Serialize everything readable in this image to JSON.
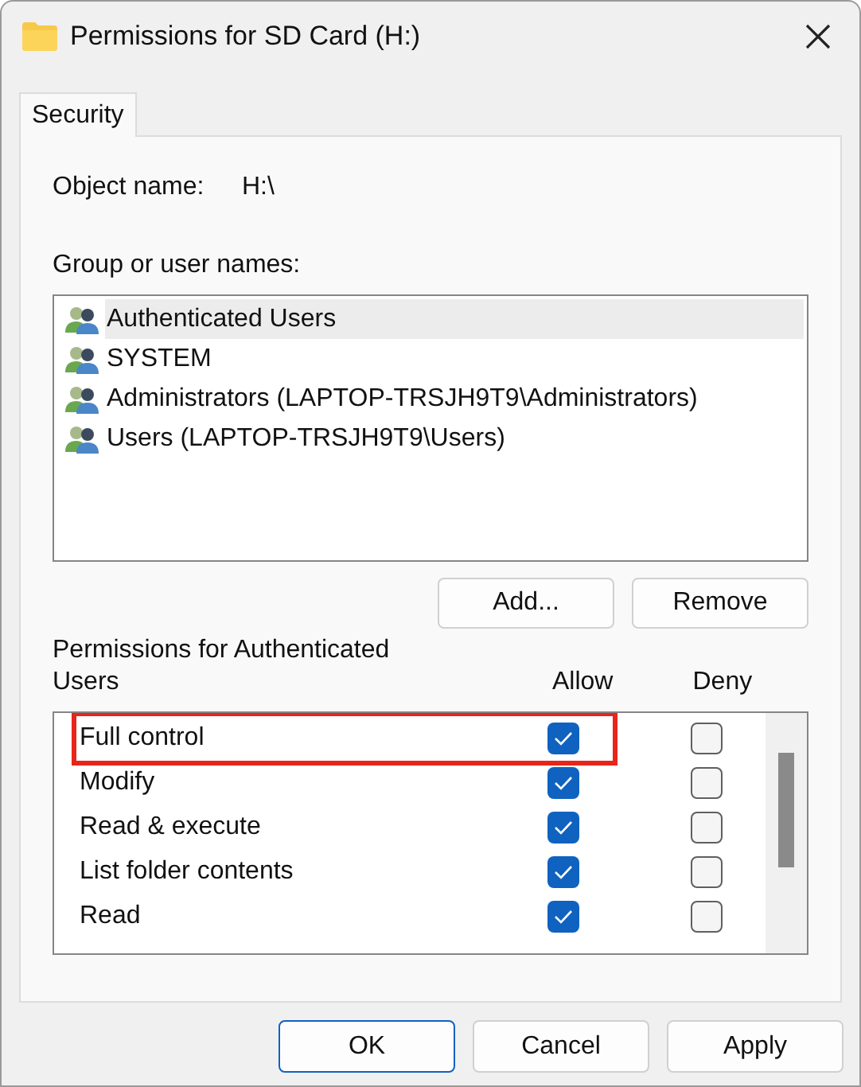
{
  "window": {
    "title": "Permissions for SD Card (H:)"
  },
  "tabs": [
    {
      "label": "Security",
      "selected": true
    }
  ],
  "object_name": {
    "label": "Object name:",
    "value": "H:\\"
  },
  "group_list": {
    "label": "Group or user names:",
    "items": [
      {
        "name": "Authenticated Users",
        "selected": true
      },
      {
        "name": "SYSTEM",
        "selected": false
      },
      {
        "name": "Administrators (LAPTOP-TRSJH9T9\\Administrators)",
        "selected": false
      },
      {
        "name": "Users (LAPTOP-TRSJH9T9\\Users)",
        "selected": false
      }
    ]
  },
  "group_buttons": [
    "Add...",
    "Remove"
  ],
  "permissions": {
    "label": "Permissions for Authenticated Users",
    "columns": [
      "Allow",
      "Deny"
    ],
    "rows": [
      {
        "name": "Full control",
        "allow": true,
        "deny": false,
        "highlighted": true
      },
      {
        "name": "Modify",
        "allow": true,
        "deny": false,
        "highlighted": false
      },
      {
        "name": "Read & execute",
        "allow": true,
        "deny": false,
        "highlighted": false
      },
      {
        "name": "List folder contents",
        "allow": true,
        "deny": false,
        "highlighted": false
      },
      {
        "name": "Read",
        "allow": true,
        "deny": false,
        "highlighted": false
      }
    ]
  },
  "buttons": [
    {
      "label": "OK",
      "kind": "default"
    },
    {
      "label": "Cancel",
      "kind": "normal"
    },
    {
      "label": "Apply",
      "kind": "normal"
    }
  ]
}
